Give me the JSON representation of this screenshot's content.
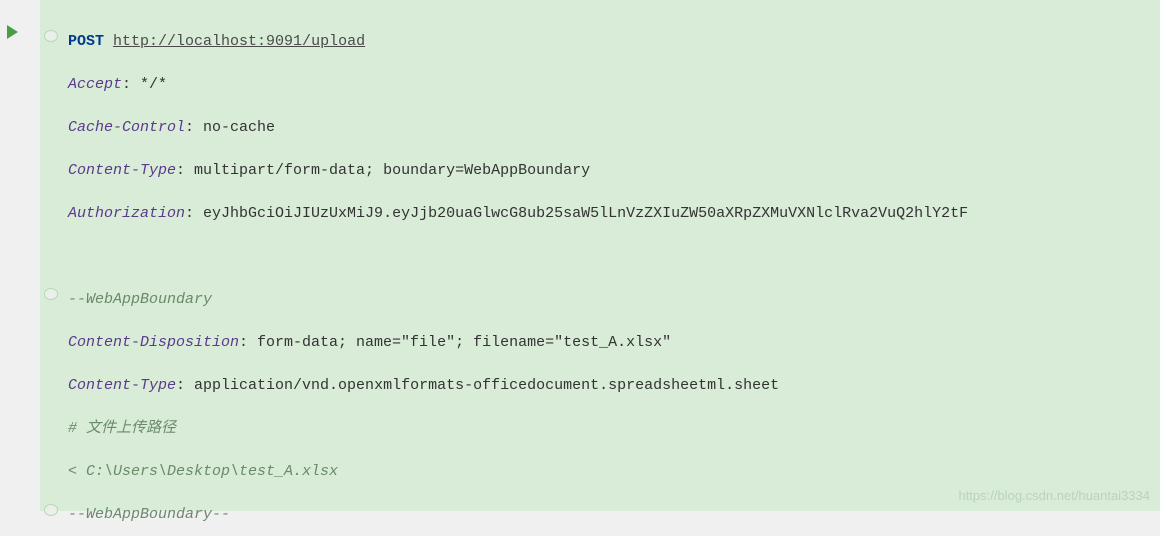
{
  "request": {
    "method": "POST",
    "url": "http://localhost:9091/upload",
    "headers": {
      "accept": {
        "name": "Accept",
        "value": ": */*"
      },
      "cache_control": {
        "name": "Cache-Control",
        "value": ": no-cache"
      },
      "content_type": {
        "name": "Content-Type",
        "value": ": multipart/form-data; boundary=WebAppBoundary"
      },
      "authorization": {
        "name": "Authorization",
        "value": ": eyJhbGciOiJIUzUxMiJ9.eyJjb20uaGlwcG8ub25saW5lLnVzZXIuZW50aXRpZXMuVXNlclRva2VuQ2hlY2tF"
      }
    },
    "boundary_open": "--WebAppBoundary",
    "part": {
      "content_disposition": {
        "name": "Content-Disposition",
        "value": ": form-data; name=\"file\"; filename=\"test_A.xlsx\""
      },
      "content_type": {
        "name": "Content-Type",
        "value": ": application/vnd.openxmlformats-officedocument.spreadsheetml.sheet"
      },
      "comment": "# 文件上传路径",
      "file_prefix": "< ",
      "file_path": "C:\\Users\\Desktop\\test_A.xlsx"
    },
    "boundary_close": "--WebAppBoundary--"
  },
  "watermark": "https://blog.csdn.net/huantai3334"
}
